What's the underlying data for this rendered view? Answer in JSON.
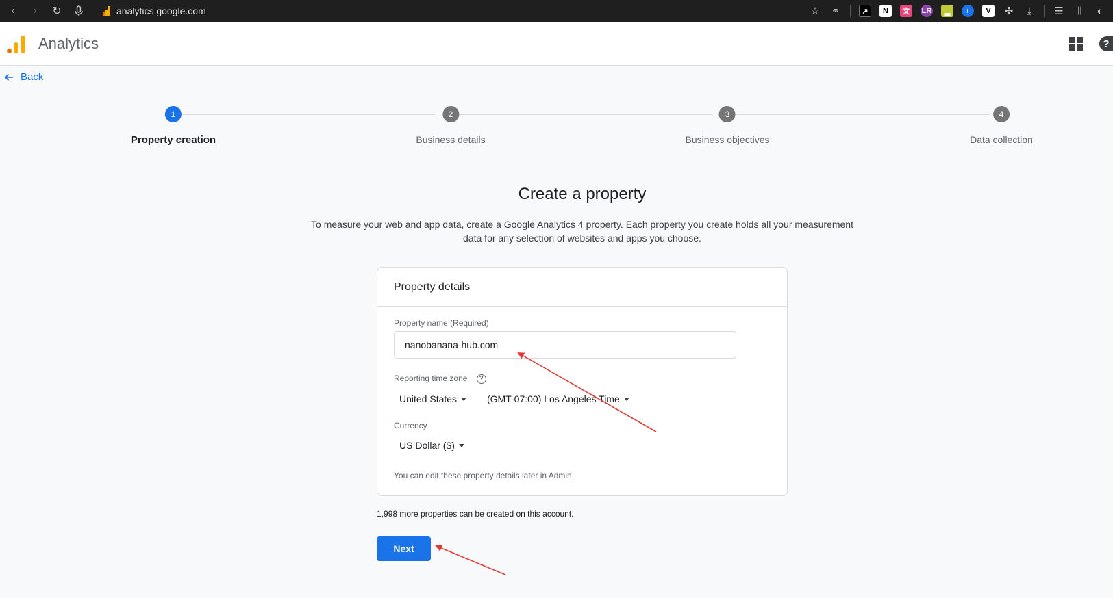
{
  "browser": {
    "url": "analytics.google.com",
    "nav_icons": [
      "back-arrow-icon",
      "forward-arrow-icon",
      "reload-icon",
      "microphone-icon"
    ],
    "extensions": [
      {
        "name": "bookmark-star-icon",
        "glyph": "☆"
      },
      {
        "name": "link-icon",
        "glyph": "⚭"
      }
    ]
  },
  "app": {
    "title": "Analytics",
    "brand_colors": [
      "#f9ab00",
      "#e37400"
    ]
  },
  "back": {
    "label": "Back"
  },
  "steps": [
    {
      "number": "1",
      "label": "Property creation",
      "active": true
    },
    {
      "number": "2",
      "label": "Business details",
      "active": false
    },
    {
      "number": "3",
      "label": "Business objectives",
      "active": false
    },
    {
      "number": "4",
      "label": "Data collection",
      "active": false
    }
  ],
  "main": {
    "title": "Create a property",
    "description": "To measure your web and app data, create a Google Analytics 4 property. Each property you create holds all your measurement data for any selection of websites and apps you choose."
  },
  "card": {
    "header": "Property details",
    "property_name_label": "Property name (Required)",
    "property_name_value": "nanobanana-hub.com",
    "timezone_label": "Reporting time zone",
    "country_value": "United States",
    "timezone_value": "(GMT-07:00) Los Angeles Time",
    "currency_label": "Currency",
    "currency_value": "US Dollar ($)",
    "hint": "You can edit these property details later in Admin"
  },
  "quota_text": "1,998 more properties can be created on this account.",
  "next_label": "Next",
  "colors": {
    "accent": "#1a73e8",
    "annotation_arrow": "#e53935"
  }
}
